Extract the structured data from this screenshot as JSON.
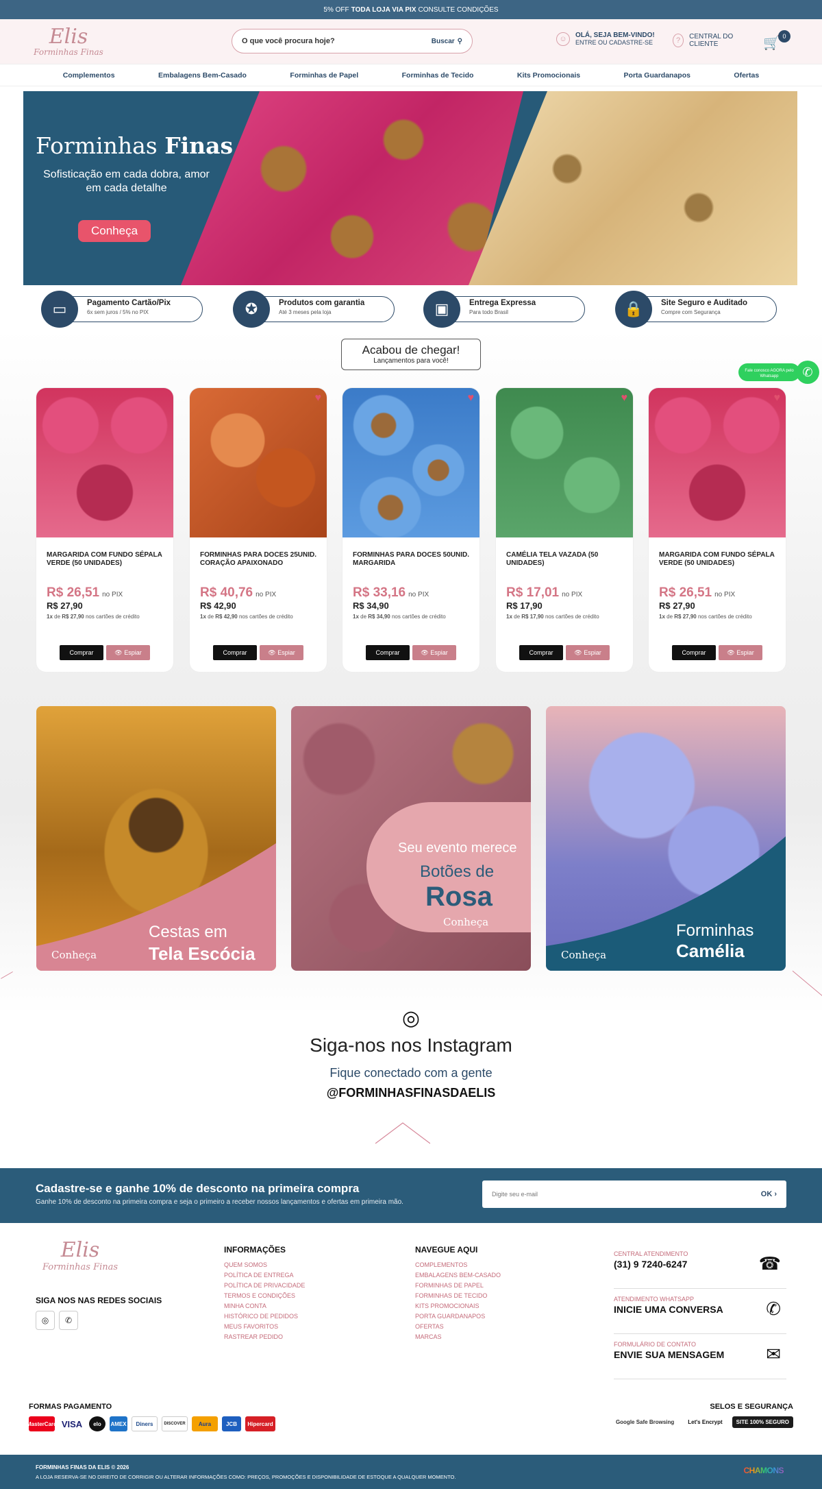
{
  "topbar": {
    "pre": "5% OFF",
    "bold": "TODA LOJA VIA PIX",
    "post": "CONSULTE CONDIÇÕES"
  },
  "logo": {
    "line1": "Elis",
    "line2": "Forminhas Finas"
  },
  "search": {
    "placeholder": "O que você procura hoje?",
    "button": "Buscar"
  },
  "user": {
    "greeting": "OLÁ, SEJA BEM-VINDO!",
    "sub": "ENTRE OU CADASTRE-SE"
  },
  "help": {
    "label": "CENTRAL DO CLIENTE"
  },
  "cart": {
    "count": "0"
  },
  "nav": [
    "Complementos",
    "Embalagens Bem-Casado",
    "Forminhas de Papel",
    "Forminhas de Tecido",
    "Kits Promocionais",
    "Porta Guardanapos",
    "Ofertas"
  ],
  "hero": {
    "title_pre": "Forminhas",
    "title_bold": "Finas",
    "subtitle": "Sofisticação em cada dobra, amor em cada detalhe",
    "button": "Conheça"
  },
  "features": [
    {
      "title": "Pagamento Cartão/Pix",
      "sub": "6x sem juros / 5% no PIX",
      "icon": "card-icon"
    },
    {
      "title": "Produtos com garantia",
      "sub": "Até 3 meses pela loja",
      "icon": "badge-icon"
    },
    {
      "title": "Entrega Expressa",
      "sub": "Para todo Brasil",
      "icon": "box-icon"
    },
    {
      "title": "Site Seguro e Auditado",
      "sub": "Compre com Segurança",
      "icon": "lock-icon"
    }
  ],
  "arrival": {
    "title": "Acabou de chegar!",
    "sub": "Lançamentos para você!"
  },
  "whatsapp": {
    "text": "Fale conosco AGORA pelo Whatsapp"
  },
  "products": [
    {
      "name": "MARGARIDA COM FUNDO SÉPALA VERDE (50 UNIDADES)",
      "pix": "R$ 26,51",
      "pix_label": "no PIX",
      "price": "R$ 27,90",
      "inst_pre": "1x",
      "inst_mid": "de",
      "inst_val": "R$ 27,90",
      "inst_post": "nos cartões de crédito",
      "buy": "Comprar",
      "spy": "👁 Espiar",
      "color": "#d1345e"
    },
    {
      "name": "FORMINHAS PARA DOCES 25UNID. CORAÇÃO APAIXONADO",
      "pix": "R$ 40,76",
      "pix_label": "no PIX",
      "price": "R$ 42,90",
      "inst_pre": "1x",
      "inst_mid": "de",
      "inst_val": "R$ 42,90",
      "inst_post": "nos cartões de crédito",
      "buy": "Comprar",
      "spy": "👁 Espiar",
      "color": "#d35a2a"
    },
    {
      "name": "FORMINHAS PARA DOCES 50UNID. MARGARIDA",
      "pix": "R$ 33,16",
      "pix_label": "no PIX",
      "price": "R$ 34,90",
      "inst_pre": "1x",
      "inst_mid": "de",
      "inst_val": "R$ 34,90",
      "inst_post": "nos cartões de crédito",
      "buy": "Comprar",
      "spy": "👁 Espiar",
      "color": "#4a8fd6"
    },
    {
      "name": "CAMÉLIA TELA VAZADA (50 UNIDADES)",
      "pix": "R$ 17,01",
      "pix_label": "no PIX",
      "price": "R$ 17,90",
      "inst_pre": "1x",
      "inst_mid": "de",
      "inst_val": "R$ 17,90",
      "inst_post": "nos cartões de crédito",
      "buy": "Comprar",
      "spy": "👁 Espiar",
      "color": "#4f9a5a"
    },
    {
      "name": "MARGARIDA COM FUNDO SÉPALA VERDE (50 UNIDADES)",
      "pix": "R$ 26,51",
      "pix_label": "no PIX",
      "price": "R$ 27,90",
      "inst_pre": "1x",
      "inst_mid": "de",
      "inst_val": "R$ 27,90",
      "inst_post": "nos cartões de crédito",
      "buy": "Comprar",
      "spy": "👁 Espiar",
      "color": "#d1345e"
    }
  ],
  "banners": [
    {
      "line1": "Cestas em",
      "line2": "Tela Escócia",
      "cta": "Conheça"
    },
    {
      "line1": "Seu evento merece",
      "line2": "Botões de",
      "line3": "Rosa",
      "cta": "Conheça"
    },
    {
      "line1": "Forminhas",
      "line2": "Camélia",
      "cta": "Conheça"
    }
  ],
  "instagram": {
    "title": "Siga-nos nos Instagram",
    "sub": "Fique conectado com a gente",
    "handle": "@FORMINHASFINASDAELIS"
  },
  "newsletter": {
    "title": "Cadastre-se e ganhe 10% de desconto na primeira compra",
    "text": "Ganhe 10% de desconto na primeira compra e seja o primeiro a receber nossos lançamentos e ofertas em primeira mão.",
    "placeholder": "Digite seu e-mail",
    "button": "OK ›"
  },
  "footer": {
    "social_title": "SIGA NOS NAS REDES SOCIAIS",
    "info_title": "INFORMAÇÕES",
    "info": [
      "QUEM SOMOS",
      "POLÍTICA DE ENTREGA",
      "POLÍTICA DE PRIVACIDADE",
      "TERMOS E CONDIÇÕES",
      "MINHA CONTA",
      "HISTÓRICO DE PEDIDOS",
      "MEUS FAVORITOS",
      "RASTREAR PEDIDO"
    ],
    "nav_title": "NAVEGUE AQUI",
    "nav": [
      "COMPLEMENTOS",
      "EMBALAGENS BEM-CASADO",
      "FORMINHAS DE PAPEL",
      "FORMINHAS DE TECIDO",
      "KITS PROMOCIONAIS",
      "PORTA GUARDANAPOS",
      "OFERTAS",
      "MARCAS"
    ],
    "contacts": [
      {
        "label": "CENTRAL ATENDIMENTO",
        "value": "(31) 9 7240-6247"
      },
      {
        "label": "ATENDIMENTO WHATSAPP",
        "value": "INICIE UMA CONVERSA"
      },
      {
        "label": "FORMULÁRIO DE CONTATO",
        "value": "ENVIE SUA MENSAGEM"
      }
    ],
    "pay_title": "FORMAS PAGAMENTO",
    "pay": [
      "MasterCard",
      "VISA",
      "elo",
      "AMEX",
      "Diners",
      "DISCOVER",
      "Aura",
      "JCB",
      "Hipercard"
    ],
    "seal_title": "SELOS E SEGURANÇA",
    "seals": [
      "Google Safe Browsing",
      "Let's Encrypt",
      "SITE 100% SEGURO"
    ],
    "copy": "FORMINHAS FINAS DA ELIS © 2026",
    "rights": "A LOJA RESERVA-SE NO DIREITO DE CORRIGIR OU ALTERAR INFORMAÇÕES COMO: PREÇOS, PROMOÇÕES E DISPONIBILIDADE DE ESTOQUE A QUALQUER MOMENTO.",
    "brand": "CHAMONS"
  }
}
